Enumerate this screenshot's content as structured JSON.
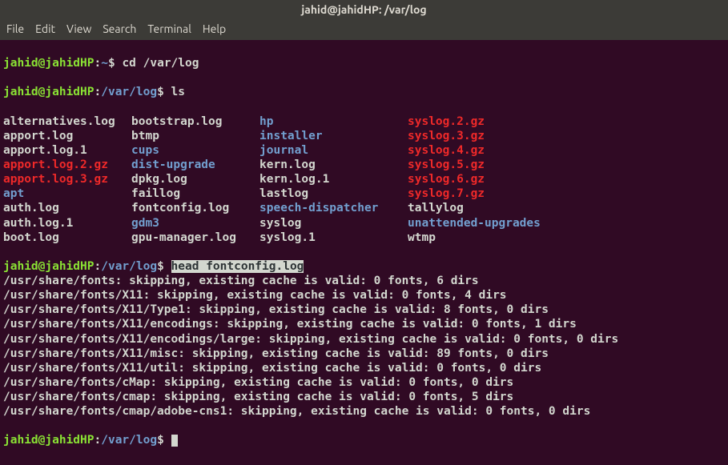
{
  "titlebar": "jahid@jahidHP: /var/log",
  "menu": [
    "File",
    "Edit",
    "View",
    "Search",
    "Terminal",
    "Help"
  ],
  "prompt": {
    "user": "jahid@jahidHP",
    "home_path": "~",
    "path": "/var/log",
    "sep": ":",
    "dollar": "$ "
  },
  "commands": {
    "cd": "cd /var/log",
    "ls": "ls",
    "head": "head fontconfig.log"
  },
  "ls_rows": [
    [
      {
        "name": "alternatives.log",
        "cls": "f-normal"
      },
      {
        "name": "bootstrap.log",
        "cls": "f-normal"
      },
      {
        "name": "hp",
        "cls": "f-dir"
      },
      {
        "name": "syslog.2.gz",
        "cls": "f-archive"
      }
    ],
    [
      {
        "name": "apport.log",
        "cls": "f-normal"
      },
      {
        "name": "btmp",
        "cls": "f-normal"
      },
      {
        "name": "installer",
        "cls": "f-dir"
      },
      {
        "name": "syslog.3.gz",
        "cls": "f-archive"
      }
    ],
    [
      {
        "name": "apport.log.1",
        "cls": "f-normal"
      },
      {
        "name": "cups",
        "cls": "f-dir"
      },
      {
        "name": "journal",
        "cls": "f-dir"
      },
      {
        "name": "syslog.4.gz",
        "cls": "f-archive"
      }
    ],
    [
      {
        "name": "apport.log.2.gz",
        "cls": "f-archive"
      },
      {
        "name": "dist-upgrade",
        "cls": "f-dir"
      },
      {
        "name": "kern.log",
        "cls": "f-normal"
      },
      {
        "name": "syslog.5.gz",
        "cls": "f-archive"
      }
    ],
    [
      {
        "name": "apport.log.3.gz",
        "cls": "f-archive"
      },
      {
        "name": "dpkg.log",
        "cls": "f-normal"
      },
      {
        "name": "kern.log.1",
        "cls": "f-normal"
      },
      {
        "name": "syslog.6.gz",
        "cls": "f-archive"
      }
    ],
    [
      {
        "name": "apt",
        "cls": "f-dir"
      },
      {
        "name": "faillog",
        "cls": "f-normal"
      },
      {
        "name": "lastlog",
        "cls": "f-normal"
      },
      {
        "name": "syslog.7.gz",
        "cls": "f-archive"
      }
    ],
    [
      {
        "name": "auth.log",
        "cls": "f-normal"
      },
      {
        "name": "fontconfig.log",
        "cls": "f-normal"
      },
      {
        "name": "speech-dispatcher",
        "cls": "f-dir"
      },
      {
        "name": "tallylog",
        "cls": "f-normal"
      }
    ],
    [
      {
        "name": "auth.log.1",
        "cls": "f-normal"
      },
      {
        "name": "gdm3",
        "cls": "f-dir"
      },
      {
        "name": "syslog",
        "cls": "f-normal"
      },
      {
        "name": "unattended-upgrades",
        "cls": "f-dir"
      }
    ],
    [
      {
        "name": "boot.log",
        "cls": "f-normal"
      },
      {
        "name": "gpu-manager.log",
        "cls": "f-normal"
      },
      {
        "name": "syslog.1",
        "cls": "f-normal"
      },
      {
        "name": "wtmp",
        "cls": "f-normal"
      }
    ]
  ],
  "head_output": [
    "/usr/share/fonts: skipping, existing cache is valid: 0 fonts, 6 dirs",
    "/usr/share/fonts/X11: skipping, existing cache is valid: 0 fonts, 4 dirs",
    "/usr/share/fonts/X11/Type1: skipping, existing cache is valid: 8 fonts, 0 dirs",
    "/usr/share/fonts/X11/encodings: skipping, existing cache is valid: 0 fonts, 1 dirs",
    "/usr/share/fonts/X11/encodings/large: skipping, existing cache is valid: 0 fonts, 0 dirs",
    "/usr/share/fonts/X11/misc: skipping, existing cache is valid: 89 fonts, 0 dirs",
    "/usr/share/fonts/X11/util: skipping, existing cache is valid: 0 fonts, 0 dirs",
    "/usr/share/fonts/cMap: skipping, existing cache is valid: 0 fonts, 0 dirs",
    "/usr/share/fonts/cmap: skipping, existing cache is valid: 0 fonts, 5 dirs",
    "/usr/share/fonts/cmap/adobe-cns1: skipping, existing cache is valid: 0 fonts, 0 dirs"
  ]
}
